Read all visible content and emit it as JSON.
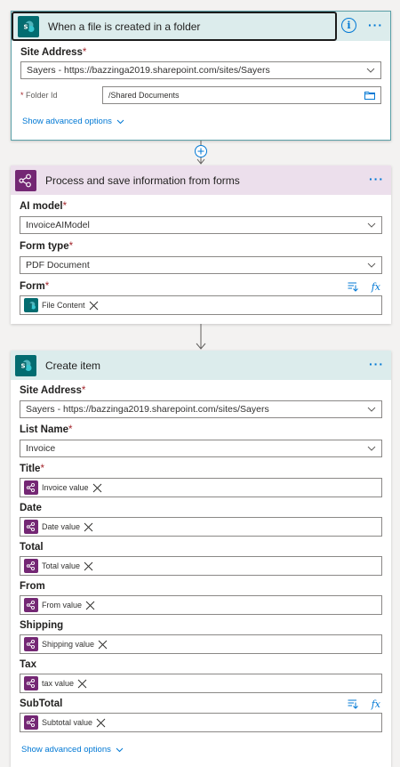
{
  "trigger": {
    "title": "When a file is created in a folder",
    "site_address_label": "Site Address",
    "site_address_value": "Sayers - https://bazzinga2019.sharepoint.com/sites/Sayers",
    "folder_id_label": "Folder Id",
    "folder_id_value": "/Shared Documents",
    "show_advanced": "Show advanced options"
  },
  "ai_action": {
    "title": "Process and save information from forms",
    "ai_model_label": "AI model",
    "ai_model_value": "InvoiceAIModel",
    "form_type_label": "Form type",
    "form_type_value": "PDF Document",
    "form_label": "Form",
    "form_token": "File Content"
  },
  "create_item": {
    "title": "Create item",
    "site_address_label": "Site Address",
    "site_address_value": "Sayers - https://bazzinga2019.sharepoint.com/sites/Sayers",
    "list_name_label": "List Name",
    "list_name_value": "Invoice",
    "fields": [
      {
        "label": "Title",
        "token": "Invoice value"
      },
      {
        "label": "Date",
        "token": "Date value"
      },
      {
        "label": "Total",
        "token": "Total value"
      },
      {
        "label": "From",
        "token": "From value"
      },
      {
        "label": "Shipping",
        "token": "Shipping value"
      },
      {
        "label": "Tax",
        "token": "tax value"
      },
      {
        "label": "SubTotal",
        "token": "Subtotal value"
      }
    ],
    "show_advanced": "Show advanced options"
  },
  "icons": {
    "sharepoint": "sharepoint-icon",
    "ai_builder": "ai-builder-icon",
    "info": "info-icon",
    "more": "more-options-icon",
    "folder": "folder-icon",
    "chevron": "chevron-down-icon",
    "dynamic_content": "dynamic-content-icon",
    "expression": "expression-icon",
    "add_step": "add-step-icon",
    "arrow": "arrow-down-icon"
  },
  "colors": {
    "sharepoint_brand": "#036c70",
    "ai_builder_brand": "#742774",
    "sharepoint_header": "#dcecec",
    "ai_header": "#ecdfec",
    "accent": "#0078d4",
    "required": "#a4262c"
  }
}
